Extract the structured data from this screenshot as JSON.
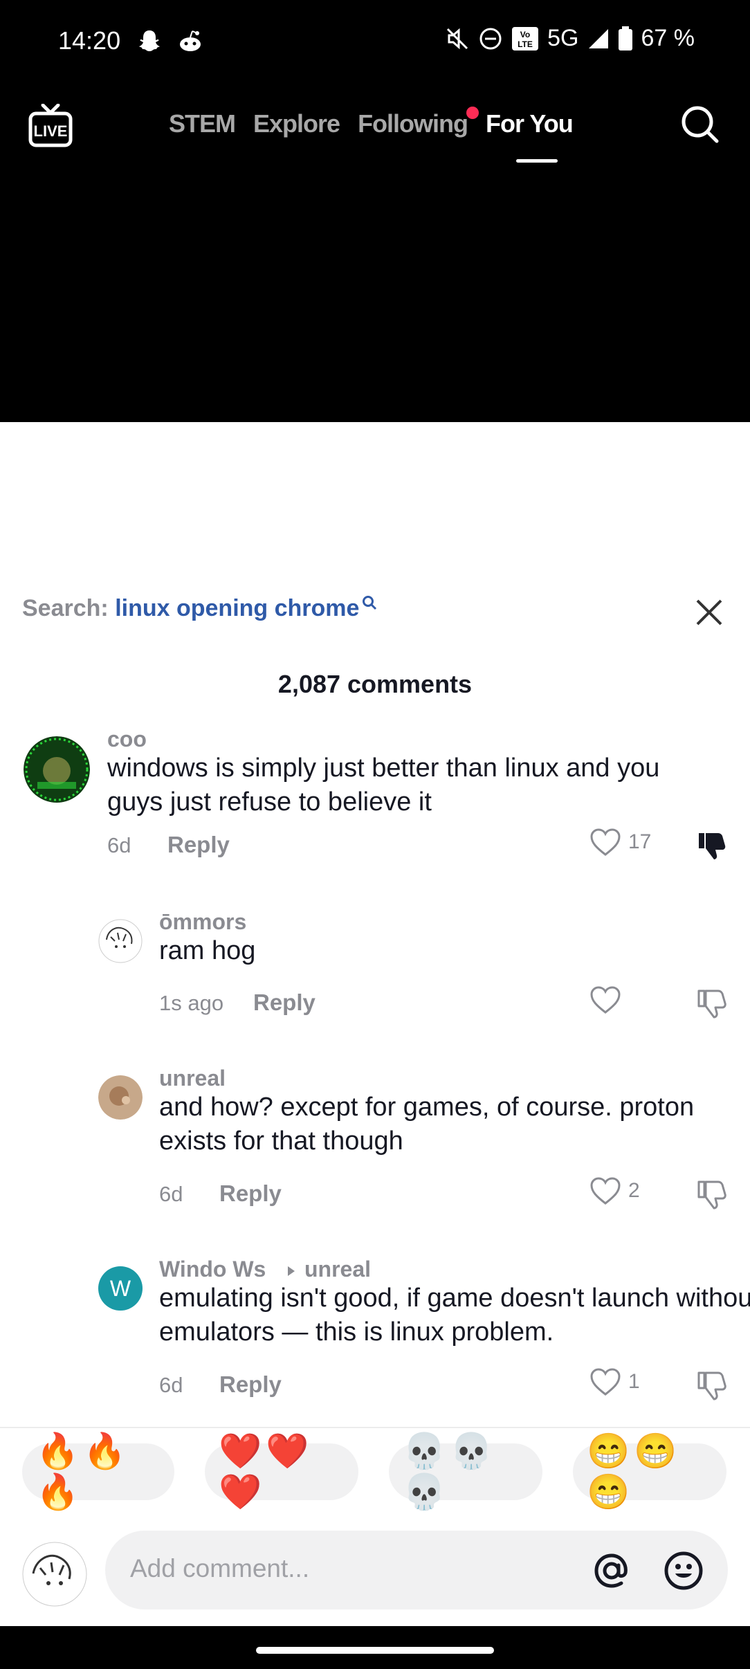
{
  "status_bar": {
    "time": "14:20",
    "network": "5G",
    "battery": "67 %"
  },
  "nav": {
    "live_label": "LIVE",
    "tabs": [
      {
        "label": "STEM",
        "active": false,
        "dot": false
      },
      {
        "label": "Explore",
        "active": false,
        "dot": false
      },
      {
        "label": "Following",
        "active": false,
        "dot": true
      },
      {
        "label": "For You",
        "active": true,
        "dot": false
      }
    ]
  },
  "comments_panel": {
    "search_label": "Search:",
    "search_query": "linux opening chrome",
    "count_label": "2,087 comments",
    "comments": [
      {
        "user": "coo",
        "text": "windows is simply just better than linux and you guys just refuse to believe it",
        "time": "6d",
        "reply": "Reply",
        "likes": "17"
      },
      {
        "user": "ōmmors",
        "text": "ram hog",
        "time": "1s ago",
        "reply": "Reply",
        "likes": ""
      },
      {
        "user": "unreal",
        "text": "and how? except for games, of course. proton exists for that though",
        "time": "6d",
        "reply": "Reply",
        "likes": "2"
      },
      {
        "user": "Windo Ws",
        "reply_to": "unreal",
        "avatar_letter": "W",
        "text": "emulating isn't good, if game doesn't launch without emulators — this is linux problem.",
        "time": "6d",
        "reply": "Reply",
        "likes": "1"
      }
    ],
    "emoji_reactions": [
      "🔥🔥🔥",
      "❤️❤️❤️",
      "💀💀💀",
      "😁😁😁"
    ],
    "composer_placeholder": "Add comment..."
  },
  "colors": {
    "accent_link": "#2f5aa8",
    "notification_dot": "#fe2c55",
    "avatar_w_bg": "#1a9aa6"
  }
}
